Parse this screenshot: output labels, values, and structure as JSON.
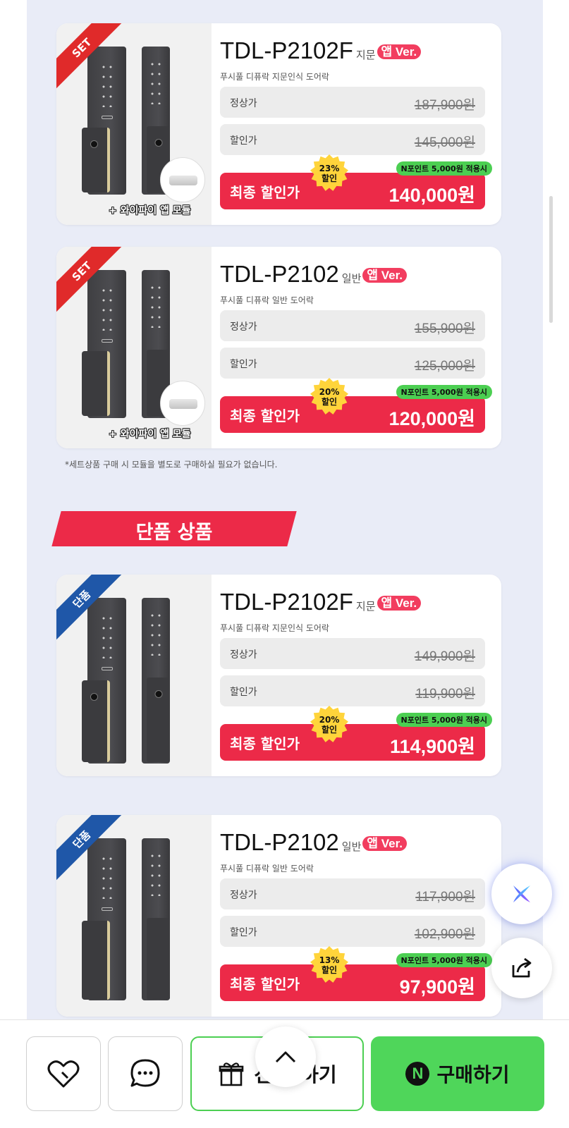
{
  "products": [
    {
      "ribbon": "SET",
      "ribbon_color": "#e02a2a",
      "model": "TDL-P2102F",
      "kind": "지문",
      "app_badge": "앱 Ver.",
      "description": "푸시풀 디퓨락 지문인식 도어락",
      "regular_label": "정상가",
      "regular_price": "187,900원",
      "discount_label": "할인가",
      "discount_price": "145,000원",
      "npoint": "N포인트 5,000원 적용시",
      "discount_rate": "23%",
      "discount_word": "할인",
      "final_label": "최종 할인가",
      "final_price": "140,000원",
      "module_label": "+ 와이파이 앱 모듈",
      "has_fingerprint": true
    },
    {
      "ribbon": "SET",
      "ribbon_color": "#e02a2a",
      "model": "TDL-P2102",
      "kind": "일반",
      "app_badge": "앱 Ver.",
      "description": "푸시풀 디퓨락 일반 도어락",
      "regular_label": "정상가",
      "regular_price": "155,900원",
      "discount_label": "할인가",
      "discount_price": "125,000원",
      "npoint": "N포인트 5,000원 적용시",
      "discount_rate": "20%",
      "discount_word": "할인",
      "final_label": "최종 할인가",
      "final_price": "120,000원",
      "module_label": "+ 와이파이 앱 모듈",
      "has_fingerprint": false
    },
    {
      "ribbon": "단품",
      "ribbon_color": "#1f57a8",
      "model": "TDL-P2102F",
      "kind": "지문",
      "app_badge": "앱 Ver.",
      "description": "푸시풀 디퓨락 지문인식 도어락",
      "regular_label": "정상가",
      "regular_price": "149,900원",
      "discount_label": "할인가",
      "discount_price": "119,900원",
      "npoint": "N포인트 5,000원 적용시",
      "discount_rate": "20%",
      "discount_word": "할인",
      "final_label": "최종 할인가",
      "final_price": "114,900원",
      "has_fingerprint": true
    },
    {
      "ribbon": "단품",
      "ribbon_color": "#1f57a8",
      "model": "TDL-P2102",
      "kind": "일반",
      "app_badge": "앱 Ver.",
      "description": "푸시풀 디퓨락 일반 도어락",
      "regular_label": "정상가",
      "regular_price": "117,900원",
      "discount_label": "할인가",
      "discount_price": "102,900원",
      "npoint": "N포인트 5,000원 적용시",
      "discount_rate": "13%",
      "discount_word": "할인",
      "final_label": "최종 할인가",
      "final_price": "97,900원",
      "has_fingerprint": false
    }
  ],
  "footnote": "*세트상품 구매 시 모듈을 별도로 구매하실 필요가 없습니다.",
  "section_title": "단품 상품",
  "bottom_bar": {
    "wishlist_icon": "heart-icon",
    "talk_icon": "chat-bubble-icon",
    "gift_label_left": "선",
    "gift_label_right": "하기",
    "buy_label": "구매하기",
    "buy_mark": "N"
  },
  "floating": {
    "assistant_icon": "ai-assistant-icon",
    "share_icon": "share-icon",
    "top_icon": "chevron-up-icon"
  },
  "colors": {
    "accent_red": "#ec2a48",
    "naver_green": "#4fd65a",
    "page_bg": "#e9ecf7"
  }
}
